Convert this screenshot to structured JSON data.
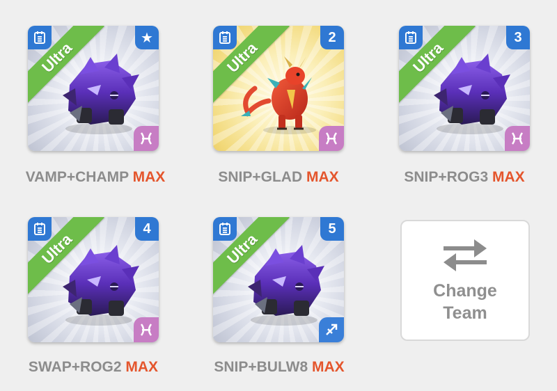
{
  "team": [
    {
      "name_text": "VAMP+CHAMP",
      "level_text": "MAX",
      "rarity": "Ultra",
      "slot_badge": "★",
      "slot_badge_icon": "star-icon",
      "element_icon": "pisces-icon",
      "creature": "dark-purple-armored-beast",
      "background": "silver"
    },
    {
      "name_text": "SNIP+GLAD",
      "level_text": "MAX",
      "rarity": "Ultra",
      "slot_badge": "2",
      "element_icon": "pisces-icon",
      "creature": "red-gold-dragon",
      "background": "gold"
    },
    {
      "name_text": "SNIP+ROG3",
      "level_text": "MAX",
      "rarity": "Ultra",
      "slot_badge": "3",
      "element_icon": "pisces-icon",
      "creature": "dark-purple-armored-beast",
      "background": "silver"
    },
    {
      "name_text": "SWAP+ROG2",
      "level_text": "MAX",
      "rarity": "Ultra",
      "slot_badge": "4",
      "element_icon": "pisces-icon",
      "creature": "dark-purple-armored-beast",
      "background": "silver"
    },
    {
      "name_text": "SNIP+BULW8",
      "level_text": "MAX",
      "rarity": "Ultra",
      "slot_badge": "5",
      "element_icon": "sagittarius-icon",
      "creature": "dark-purple-armored-beast",
      "background": "silver"
    }
  ],
  "change_team": {
    "label": "Change Team",
    "icon": "swap-arrows-icon"
  },
  "colors": {
    "page_bg": "#efefef",
    "badge_blue": "#2f78d3",
    "ribbon_green": "#6ebd4a",
    "max_orange": "#e4552c",
    "label_gray": "#8c8c8c",
    "pisces_pink": "#c77dc4"
  }
}
